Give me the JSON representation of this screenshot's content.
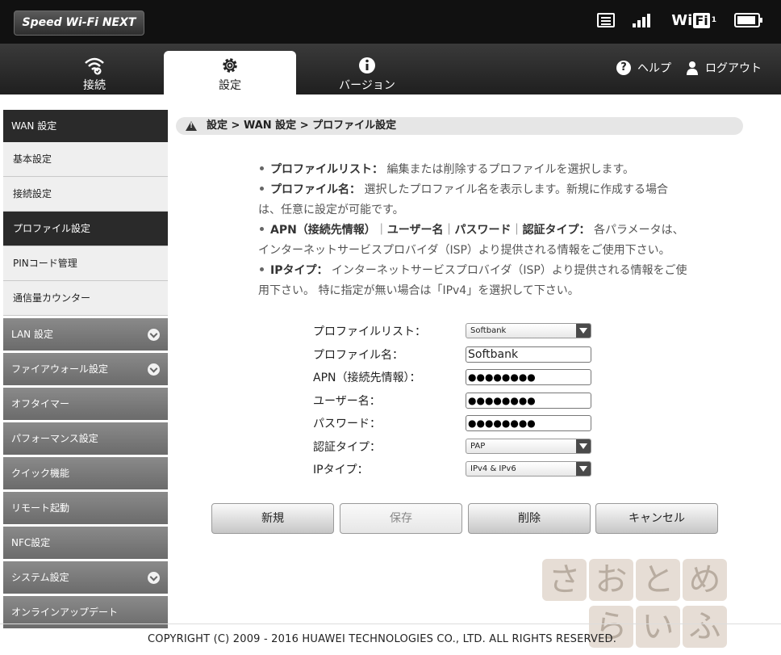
{
  "header": {
    "brand": "Speed Wi-Fi NEXT",
    "wifi_label": "Wi",
    "wifi_fi": "Fi",
    "wifi_sub": "1"
  },
  "nav": {
    "tabs": [
      {
        "label": "接続",
        "icon": "wifi-icon"
      },
      {
        "label": "設定",
        "icon": "gear-icon"
      },
      {
        "label": "バージョン",
        "icon": "info-icon"
      }
    ],
    "help": "ヘルプ",
    "logout": "ログアウト"
  },
  "sidebar": {
    "header": "WAN 設定",
    "sub_items": [
      "基本設定",
      "接続設定",
      "プロファイル設定",
      "PINコード管理",
      "通信量カウンター"
    ],
    "items": [
      {
        "label": "LAN 設定"
      },
      {
        "label": "ファイアウォール設定"
      },
      {
        "label": "オフタイマー"
      },
      {
        "label": "パフォーマンス設定"
      },
      {
        "label": "クイック機能"
      },
      {
        "label": "リモート起動"
      },
      {
        "label": "NFC設定"
      },
      {
        "label": "システム設定"
      },
      {
        "label": "オンラインアップデート"
      }
    ]
  },
  "breadcrumb": "設定 > WAN 設定 > プロファイル設定",
  "description": {
    "d1_title": "プロファイルリスト：",
    "d1_text": " 編集または削除するプロファイルを選択します。",
    "d2_title": "プロファイル名：",
    "d2_text": " 選択したプロファイル名を表示します。新規に作成する場合",
    "d2_text2": "は、任意に設定が可能です。",
    "d3_t1": "APN（接続先情報）",
    "d3_sep1": "｜",
    "d3_t2": "ユーザー名",
    "d3_sep2": "｜",
    "d3_t3": "パスワード",
    "d3_sep3": "｜",
    "d3_t4": "認証タイプ：",
    "d3_text": " 各パラメータは、",
    "d3_text2": "インターネットサービスプロバイダ（ISP）より提供される情報をご使用下さい。",
    "d4_title": "IPタイプ：",
    "d4_text": " インターネットサービスプロバイダ（ISP）より提供される情報をご使",
    "d4_text2": "用下さい。 特に指定が無い場合は「IPv4」を選択して下さい。"
  },
  "form": {
    "profile_list_label": "プロファイルリスト：",
    "profile_list_value": "Softbank",
    "profile_name_label": "プロファイル名：",
    "profile_name_value": "Softbank",
    "apn_label": "APN（接続先情報）：",
    "apn_value": "●●●●●●●●",
    "user_label": "ユーザー名：",
    "user_value": "●●●●●●●●",
    "password_label": "パスワード：",
    "password_value": "●●●●●●●●",
    "auth_label": "認証タイプ：",
    "auth_value": "PAP",
    "ip_label": "IPタイプ：",
    "ip_value": "IPv4 & IPv6"
  },
  "buttons": {
    "new": "新規",
    "save": "保存",
    "delete": "削除",
    "cancel": "キャンセル"
  },
  "footer": "COPYRIGHT (C) 2009 - 2016 HUAWEI TECHNOLOGIES CO., LTD. ALL RIGHTS RESERVED.",
  "watermark": [
    "さ",
    "お",
    "と",
    "め",
    "ら",
    "い",
    "ふ"
  ]
}
